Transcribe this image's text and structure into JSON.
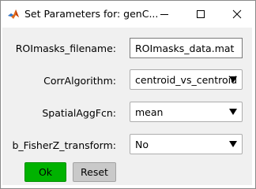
{
  "window": {
    "title": "Set Parameters for: genC...",
    "icons": {
      "app": "matlab-icon",
      "minimize": "minimize-icon",
      "maximize": "maximize-icon",
      "close": "close-icon"
    }
  },
  "form": {
    "fields": [
      {
        "label": "ROImasks_filename:",
        "value": "ROImasks_data.mat",
        "kind": "text"
      },
      {
        "label": "CorrAlgorithm:",
        "value": "centroid_vs_centroid",
        "kind": "dropdown"
      },
      {
        "label": "SpatialAggFcn:",
        "value": "mean",
        "kind": "dropdown"
      },
      {
        "label": "b_FisherZ_transform:",
        "value": "No",
        "kind": "dropdown"
      }
    ],
    "buttons": {
      "ok": "Ok",
      "reset": "Reset"
    }
  },
  "colors": {
    "ok_button": "#00b200",
    "reset_button": "#c9c9c9",
    "panel_bg": "#f0f0f0"
  }
}
